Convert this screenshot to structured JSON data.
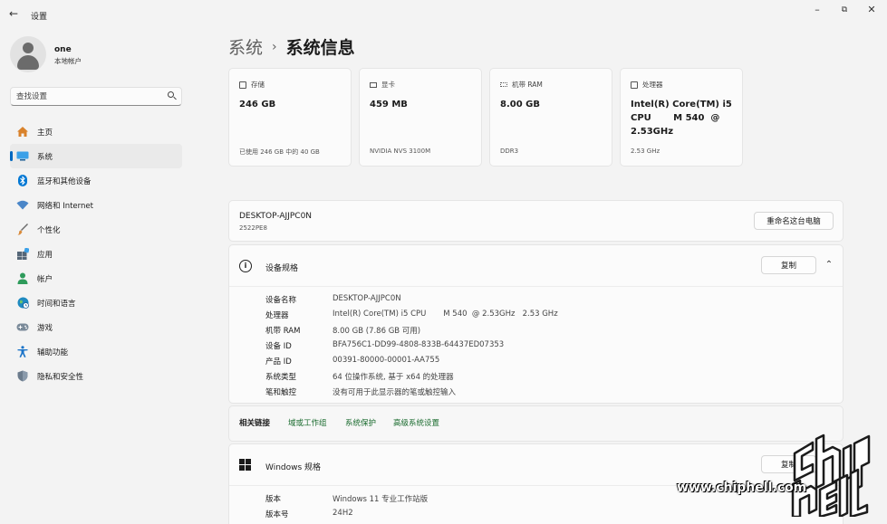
{
  "window": {
    "title": "设置",
    "back": "←",
    "minimize": "–",
    "restore": "⧉",
    "close": "✕"
  },
  "user": {
    "name": "one",
    "account_type": "本地帐户"
  },
  "search": {
    "placeholder": "查找设置"
  },
  "sidebar": {
    "items": [
      {
        "label": "主页",
        "icon": "home-icon",
        "color": "#d9822b"
      },
      {
        "label": "系统",
        "icon": "monitor-icon",
        "color": "#0078d4",
        "active": true
      },
      {
        "label": "蓝牙和其他设备",
        "icon": "bluetooth-icon",
        "color": "#0078d4"
      },
      {
        "label": "网络和 Internet",
        "icon": "wifi-icon",
        "color": "#4a86c8"
      },
      {
        "label": "个性化",
        "icon": "brush-icon",
        "color": "#d98a3a"
      },
      {
        "label": "应用",
        "icon": "apps-icon",
        "color": "#556677"
      },
      {
        "label": "帐户",
        "icon": "person-icon",
        "color": "#2e9b5b"
      },
      {
        "label": "时间和语言",
        "icon": "globe-clock-icon",
        "color": "#1f8ac0"
      },
      {
        "label": "游戏",
        "icon": "gamepad-icon",
        "color": "#7a8a99"
      },
      {
        "label": "辅助功能",
        "icon": "accessibility-icon",
        "color": "#1a73c8"
      },
      {
        "label": "隐私和安全性",
        "icon": "shield-icon",
        "color": "#6b7b8c"
      }
    ]
  },
  "header": {
    "parent": "系统",
    "separator": "›",
    "current": "系统信息"
  },
  "cards": [
    {
      "title": "存储",
      "icon": "storage-icon",
      "value": "246 GB",
      "sub": "已使用 246 GB 中的 40 GB"
    },
    {
      "title": "显卡",
      "icon": "gpu-icon",
      "value": "459 MB",
      "sub": "NVIDIA NVS 3100M"
    },
    {
      "title": "机带 RAM",
      "icon": "ram-icon",
      "value": "8.00 GB",
      "sub": "DDR3"
    },
    {
      "title": "处理器",
      "icon": "cpu-icon",
      "value": "Intel(R) Core(TM) i5 CPU       M 540  @ 2.53GHz",
      "sub": "2.53 GHz"
    }
  ],
  "pc": {
    "name": "DESKTOP-AJJPC0N",
    "model": "2522PE8",
    "rename_button": "重命名这台电脑"
  },
  "device_specs": {
    "title": "设备规格",
    "copy_button": "复制",
    "rows": [
      {
        "key": "设备名称",
        "value": "DESKTOP-AJJPC0N"
      },
      {
        "key": "处理器",
        "value": "Intel(R) Core(TM) i5 CPU       M 540  @ 2.53GHz   2.53 GHz"
      },
      {
        "key": "机带 RAM",
        "value": "8.00 GB (7.86 GB 可用)"
      },
      {
        "key": "设备 ID",
        "value": "BFA756C1-DD99-4808-833B-64437ED07353"
      },
      {
        "key": "产品 ID",
        "value": "00391-80000-00001-AA755"
      },
      {
        "key": "系统类型",
        "value": "64 位操作系统, 基于 x64 的处理器"
      },
      {
        "key": "笔和触控",
        "value": "没有可用于此显示器的笔或触控输入"
      }
    ]
  },
  "related": {
    "title": "相关链接",
    "links": [
      "域或工作组",
      "系统保护",
      "高级系统设置"
    ]
  },
  "windows_specs": {
    "title": "Windows 规格",
    "copy_button": "复制",
    "rows": [
      {
        "key": "版本",
        "value": "Windows 11 专业工作站版"
      },
      {
        "key": "版本号",
        "value": "24H2"
      }
    ]
  },
  "watermark": {
    "url": "www.chiphell.com",
    "logo_text": "chip hell"
  }
}
